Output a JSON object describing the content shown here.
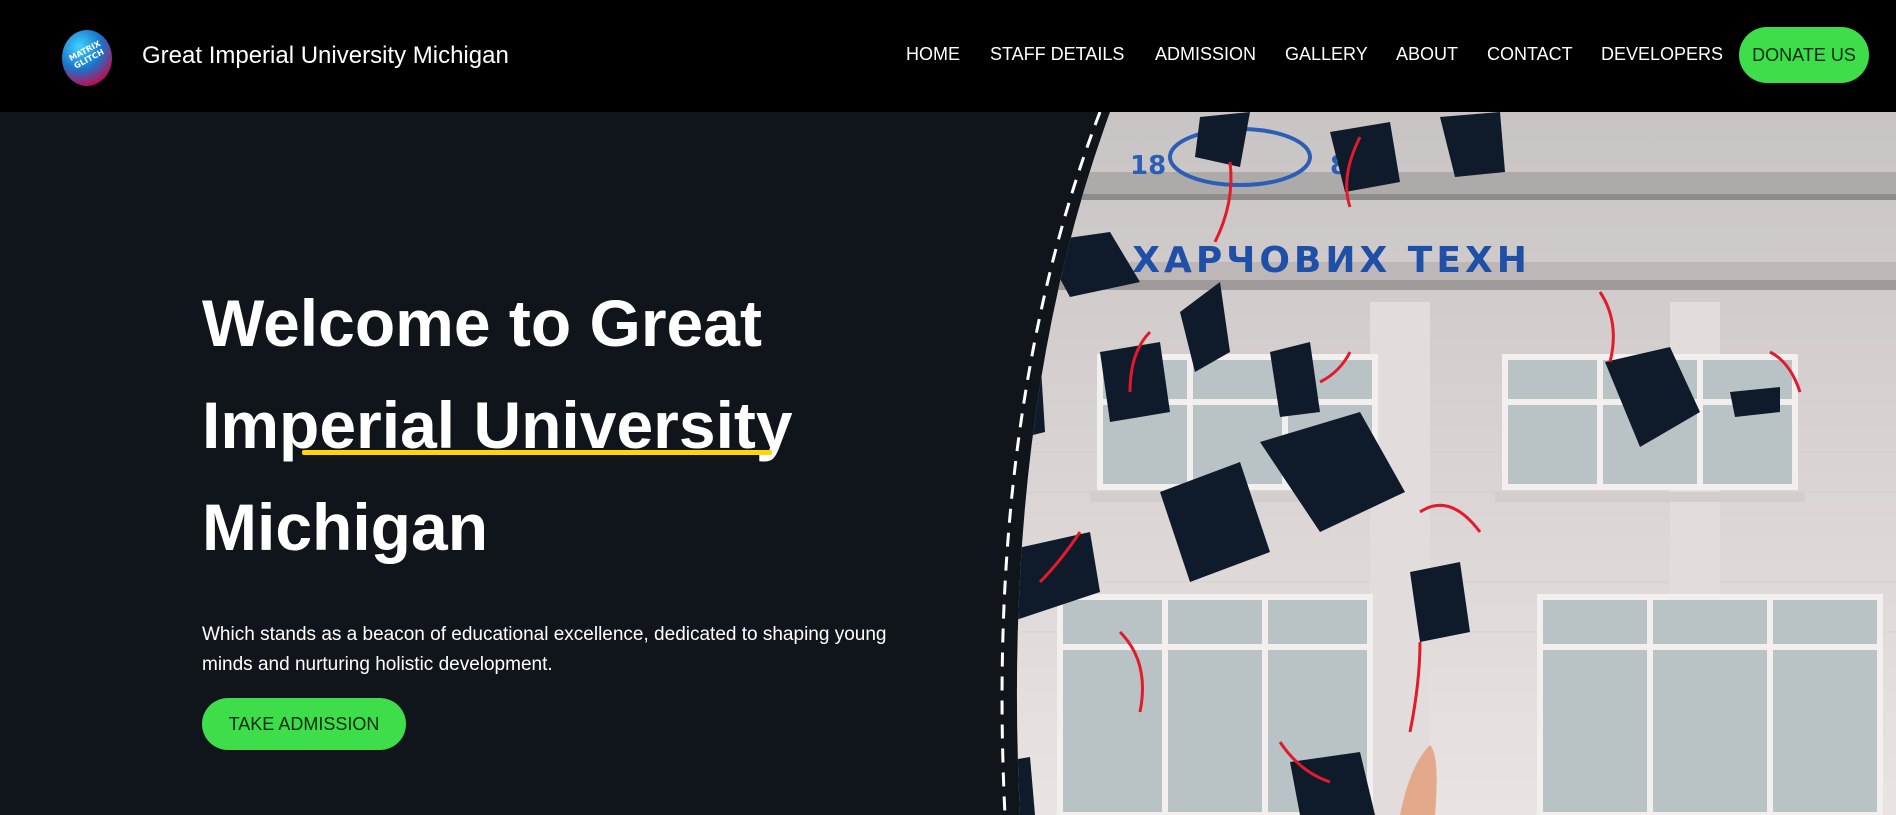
{
  "header": {
    "logo_text": "MATRIX GLITCH",
    "site_title": "Great Imperial University Michigan",
    "nav": [
      {
        "label": "HOME"
      },
      {
        "label": "STAFF DETAILS"
      },
      {
        "label": "ADMISSION"
      },
      {
        "label": "GALLERY"
      },
      {
        "label": "ABOUT"
      },
      {
        "label": "CONTACT"
      },
      {
        "label": "DEVELOPERS"
      }
    ],
    "donate_label": "DONATE US"
  },
  "hero": {
    "heading": "Welcome to Great Imperial University Michigan",
    "description": "Which stands as a beacon of educational excellence, dedicated to shaping young minds and nurturing holistic development.",
    "cta_label": "TAKE ADMISSION",
    "building_sign": "ТЕТ ХАРЧОВИХ ТЕХН"
  },
  "colors": {
    "header_bg": "#000000",
    "page_bg": "#10141b",
    "accent_green": "#3dde4a",
    "underline_yellow": "#ffd60a"
  }
}
